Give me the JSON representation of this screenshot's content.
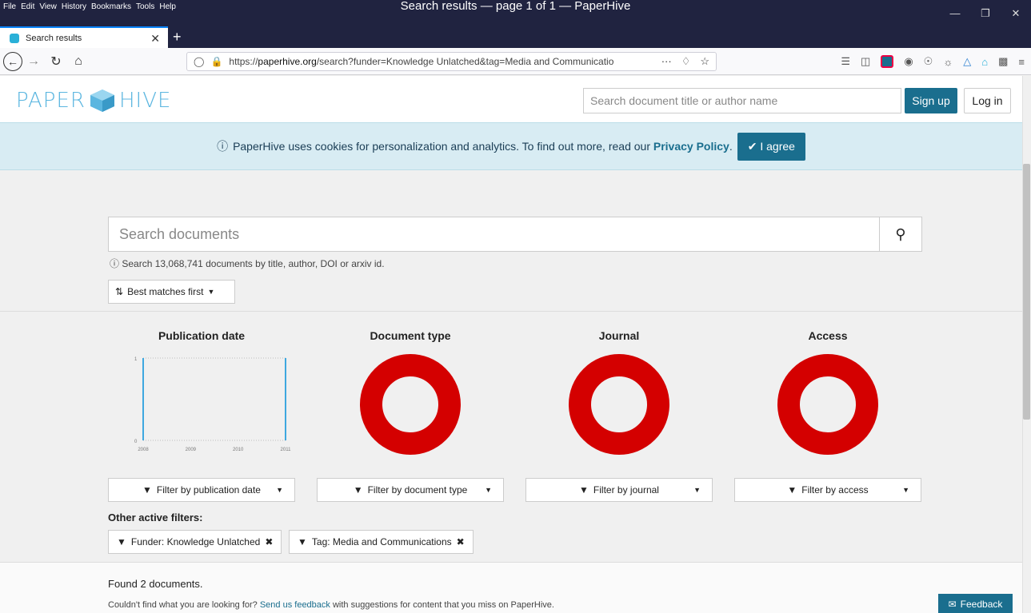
{
  "browser": {
    "menu": [
      "File",
      "Edit",
      "View",
      "History",
      "Bookmarks",
      "Tools",
      "Help"
    ],
    "window_title": "Search results — page 1 of 1 — PaperHive",
    "tab_title": "Search results",
    "url_prefix": "https://",
    "url_domain": "paperhive.org",
    "url_rest": "/search?funder=Knowledge Unlatched&tag=Media and Communicatio",
    "url_more": "···"
  },
  "header": {
    "logo_left": "PAPER",
    "logo_right": "HIVE",
    "search_placeholder": "Search document title or author name",
    "signup_label": "Sign up",
    "login_label": "Log in"
  },
  "cookie": {
    "text": "PaperHive uses cookies for personalization and analytics. To find out more, read our",
    "link": "Privacy Policy",
    "period": ".",
    "agree_label": "I agree"
  },
  "search": {
    "placeholder": "Search documents",
    "hint": "Search 13,068,741 documents by title, author, DOI or arxiv id.",
    "sort_label": "Best matches first"
  },
  "facets": [
    {
      "title": "Publication date",
      "filter": "Filter by publication date"
    },
    {
      "title": "Document type",
      "filter": "Filter by document type"
    },
    {
      "title": "Journal",
      "filter": "Filter by journal"
    },
    {
      "title": "Access",
      "filter": "Filter by access"
    }
  ],
  "chart_data": {
    "type": "bar",
    "title": "Publication date",
    "x": [
      "2008",
      "2009",
      "2010",
      "2011"
    ],
    "ylim": [
      0,
      1
    ],
    "yticks": [
      "0",
      "1"
    ],
    "series": [
      {
        "values": [
          1,
          0,
          0,
          1
        ]
      }
    ],
    "color": "#3ea8e0"
  },
  "donut_color": "#d40000",
  "other_filters": {
    "label": "Other active filters:",
    "chips": [
      "Funder: Knowledge Unlatched",
      "Tag: Media and Communications"
    ]
  },
  "results": {
    "found": "Found 2 documents.",
    "missing_prefix": "Couldn't find what you are looking for?",
    "missing_link": "Send us feedback",
    "missing_suffix": "with suggestions for content that you miss on PaperHive.",
    "feedback_label": "Feedback"
  }
}
